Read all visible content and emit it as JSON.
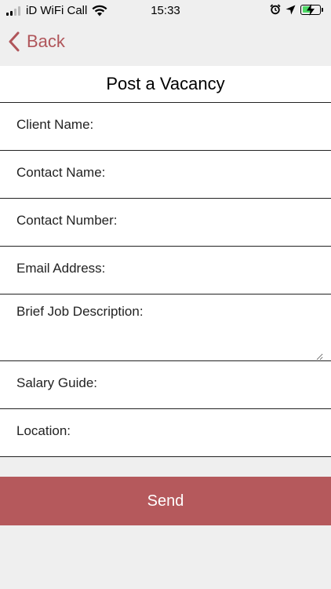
{
  "status_bar": {
    "carrier": "iD WiFi Call",
    "time": "15:33",
    "battery_level": 0.55
  },
  "nav": {
    "back_label": "Back"
  },
  "form": {
    "title": "Post a Vacancy",
    "fields": [
      {
        "label": "Client Name:",
        "value": ""
      },
      {
        "label": "Contact Name:",
        "value": ""
      },
      {
        "label": "Contact Number:",
        "value": ""
      },
      {
        "label": "Email Address:",
        "value": ""
      },
      {
        "label": "Brief Job Description:",
        "value": ""
      },
      {
        "label": "Salary Guide:",
        "value": ""
      },
      {
        "label": "Location:",
        "value": ""
      }
    ]
  },
  "send_label": "Send",
  "colors": {
    "accent": "#b0555a",
    "send_button": "#b5595c",
    "background": "#efefef",
    "battery_fill": "#4cd964"
  },
  "icons": {
    "signal": "signal-bars-icon",
    "wifi": "wifi-icon",
    "alarm": "alarm-clock-icon",
    "location": "location-arrow-icon",
    "battery": "battery-charging-icon",
    "back": "chevron-left-icon"
  }
}
